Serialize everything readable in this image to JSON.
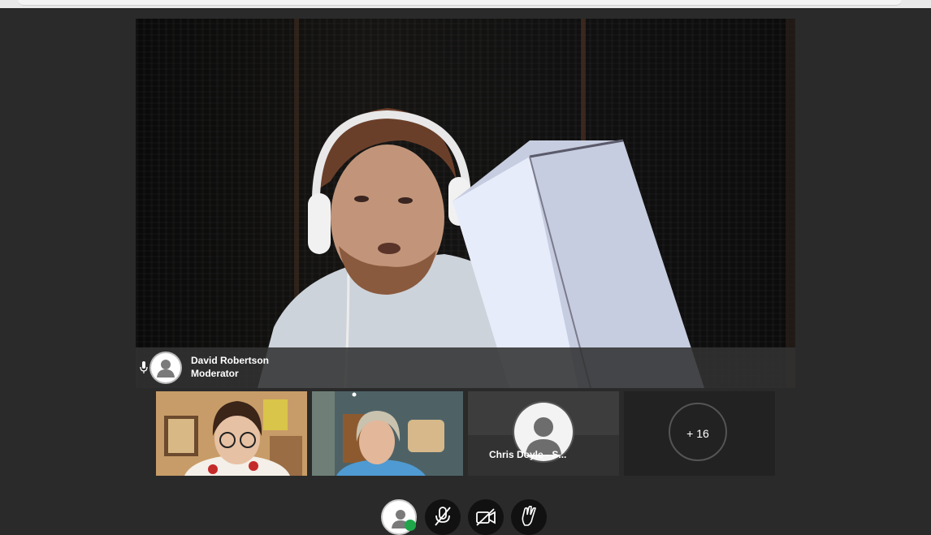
{
  "main_speaker": {
    "name": "David Robertson",
    "role": "Moderator",
    "icons": {
      "mic": "microphone-icon",
      "avatar": "user-avatar-icon"
    }
  },
  "participants": [
    {
      "id": "p1",
      "type": "video"
    },
    {
      "id": "p2",
      "type": "video"
    },
    {
      "id": "p3",
      "type": "avatar",
      "name": "Chris Doyle - S..."
    }
  ],
  "overflow": {
    "label": "+ 16"
  },
  "controls": [
    {
      "id": "self-avatar",
      "icon": "user-avatar-icon"
    },
    {
      "id": "mute",
      "icon": "microphone-off-icon"
    },
    {
      "id": "camera",
      "icon": "camera-off-icon"
    },
    {
      "id": "raise-hand",
      "icon": "raise-hand-icon"
    }
  ],
  "colors": {
    "background": "#2a2a2a",
    "status_online": "#1fa64a"
  }
}
